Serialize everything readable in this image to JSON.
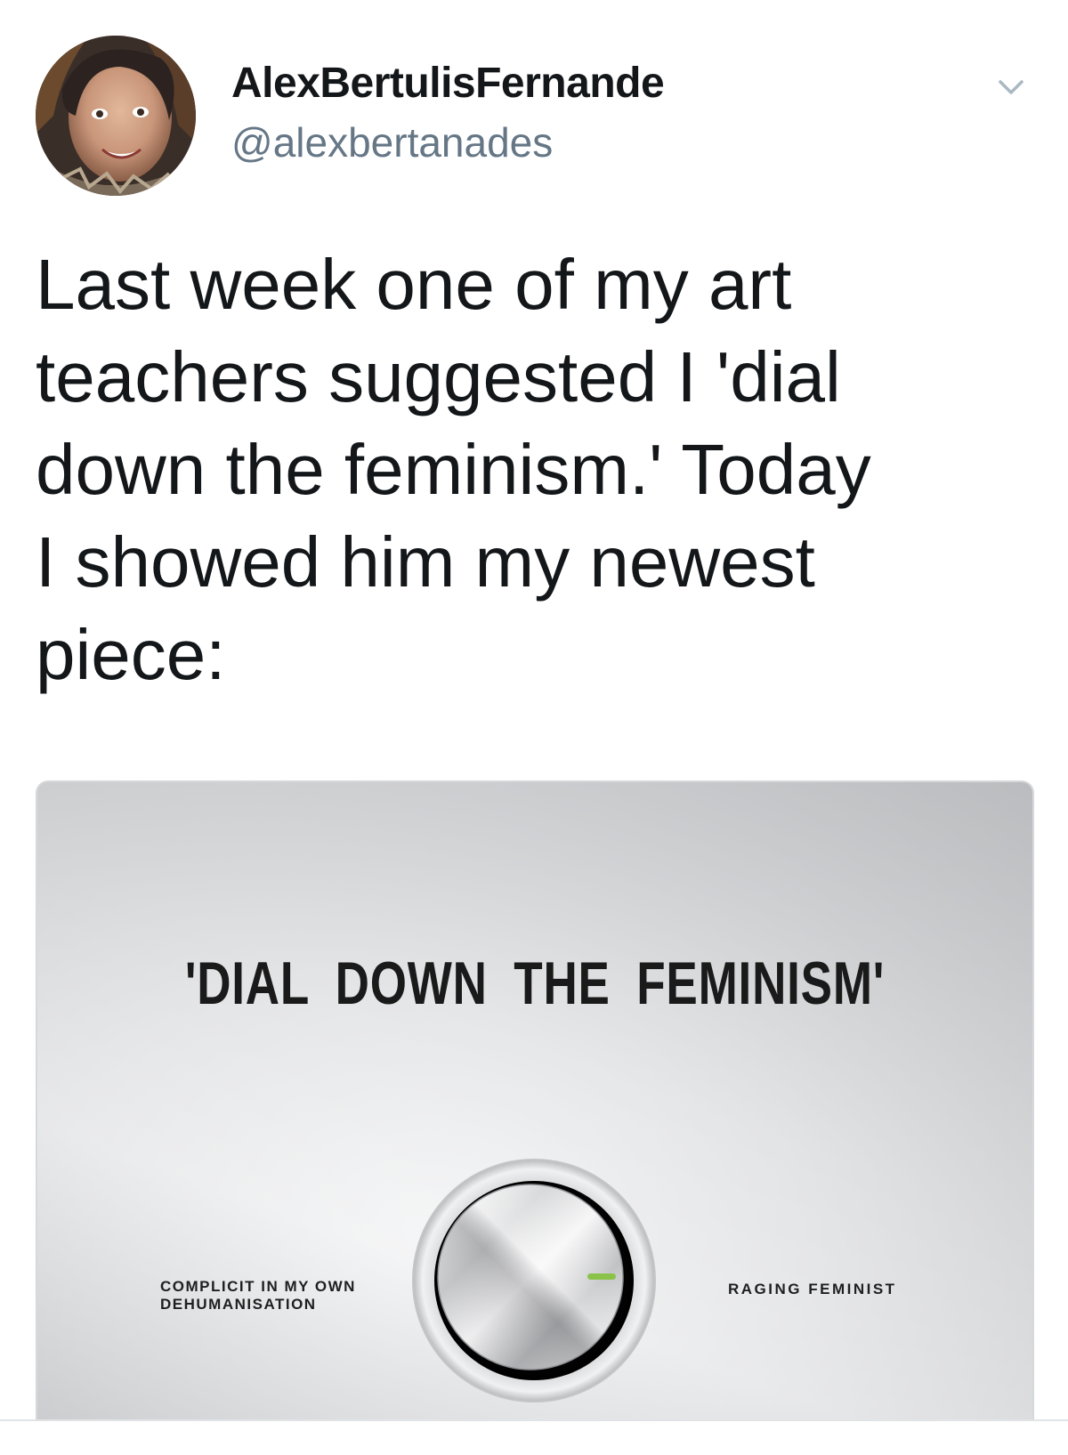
{
  "author": {
    "display_name": "AlexBertulisFernande",
    "handle": "@alexbertanades",
    "avatar_icon": "profile-photo",
    "menu_icon": "chevron-down-icon"
  },
  "tweet": {
    "text": "Last week one of my art\nteachers suggested I 'dial\ndown the feminism.' Today\nI showed him my newest\npiece:"
  },
  "media": {
    "title": "'DIAL  DOWN  THE  FEMINISM'",
    "left_label": "COMPLICIT IN MY OWN\nDEHUMANISATION",
    "right_label": "RAGING FEMINIST",
    "dial_icon": "volume-knob",
    "indicator_color": "#8bc34a"
  },
  "colors": {
    "text_primary": "#14171a",
    "text_secondary": "#657786",
    "border": "#d6d9dc"
  }
}
